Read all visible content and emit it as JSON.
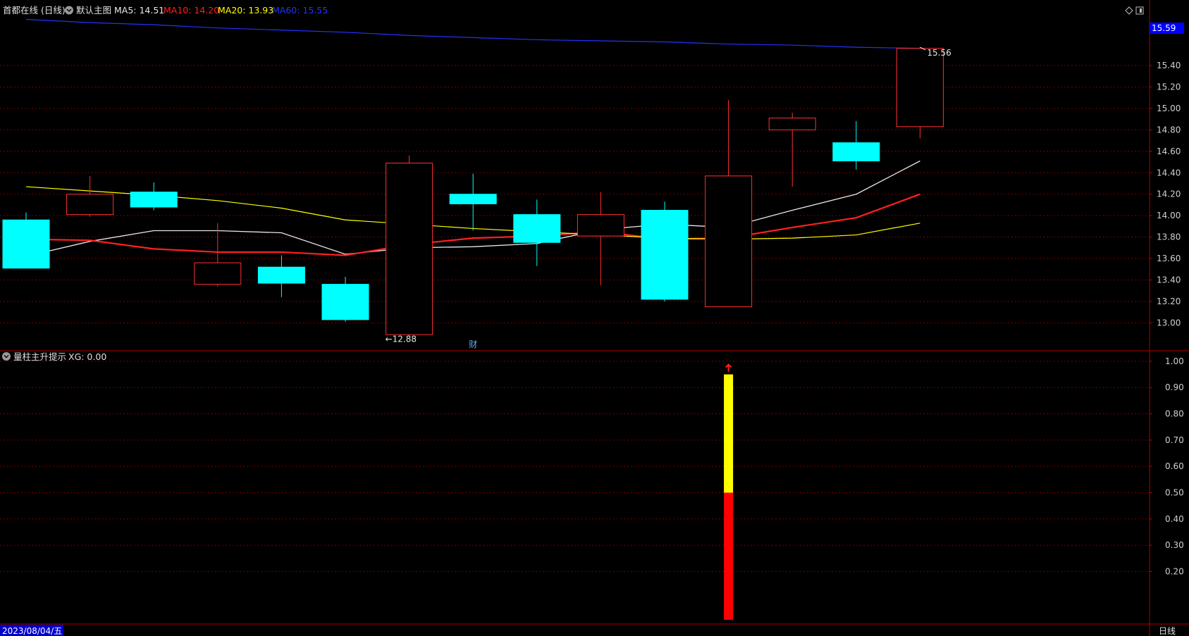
{
  "header": {
    "stock_title": "首都在线 (日线)",
    "main_chart_label": "默认主图",
    "ma_labels": [
      {
        "text": "MA5: 14.51",
        "color": "#e8e8e8"
      },
      {
        "text": "MA10: 14.20",
        "color": "#ff2020"
      },
      {
        "text": "MA20: 13.93",
        "color": "#ffff00"
      },
      {
        "text": "MA60: 15.55",
        "color": "#2233ff"
      }
    ]
  },
  "sub_header": {
    "indicator_label": "量柱主升提示",
    "xg_label": "XG: 0.00"
  },
  "footer": {
    "date_label": "2023/08/04/五",
    "period_label": "日线"
  },
  "colors": {
    "up": "#ff3030",
    "down": "#00ffff",
    "ma5": "#e8e8e8",
    "ma10": "#ff2020",
    "ma20": "#ffff00",
    "ma60": "#2233ff",
    "grid": "#7a0000",
    "axis_text": "#d0d0d0",
    "price_tag_bg": "#0000ff"
  },
  "chart_data": [
    {
      "type": "candlestick",
      "title": "首都在线 (日线)",
      "yticks": [
        "13.00",
        "13.20",
        "13.40",
        "13.60",
        "13.80",
        "14.00",
        "14.20",
        "14.40",
        "14.60",
        "14.80",
        "15.00",
        "15.20",
        "15.40"
      ],
      "ylim": [
        12.74,
        15.84
      ],
      "grid": true,
      "current_price_tag": "15.59",
      "annotations": [
        {
          "text": "←12.88",
          "at_index": 6
        },
        {
          "text": "15.56",
          "at_index": 14
        },
        {
          "text": "财",
          "at_index": 7
        }
      ],
      "candles": [
        {
          "open": 13.96,
          "close": 13.51,
          "high": 14.03,
          "low": 13.51
        },
        {
          "open": 14.01,
          "close": 14.2,
          "high": 14.37,
          "low": 13.99
        },
        {
          "open": 14.22,
          "close": 14.08,
          "high": 14.31,
          "low": 14.05
        },
        {
          "open": 13.36,
          "close": 13.56,
          "high": 13.93,
          "low": 13.34
        },
        {
          "open": 13.52,
          "close": 13.37,
          "high": 13.63,
          "low": 13.24
        },
        {
          "open": 13.36,
          "close": 13.03,
          "high": 13.43,
          "low": 13.01
        },
        {
          "open": 12.89,
          "close": 14.49,
          "high": 14.56,
          "low": 12.88
        },
        {
          "open": 14.2,
          "close": 14.11,
          "high": 14.39,
          "low": 13.86
        },
        {
          "open": 14.01,
          "close": 13.75,
          "high": 14.15,
          "low": 13.53
        },
        {
          "open": 13.81,
          "close": 14.01,
          "high": 14.22,
          "low": 13.35
        },
        {
          "open": 14.05,
          "close": 13.22,
          "high": 14.13,
          "low": 13.2
        },
        {
          "open": 13.15,
          "close": 14.37,
          "high": 15.08,
          "low": 13.15
        },
        {
          "open": 14.8,
          "close": 14.91,
          "high": 14.96,
          "low": 14.27
        },
        {
          "open": 14.68,
          "close": 14.51,
          "high": 14.88,
          "low": 14.43
        },
        {
          "open": 14.83,
          "close": 15.56,
          "high": 15.57,
          "low": 14.72
        }
      ],
      "series": [
        {
          "name": "MA5",
          "values": [
            13.62,
            13.76,
            13.86,
            13.86,
            13.84,
            13.64,
            13.7,
            13.71,
            13.74,
            13.87,
            13.92,
            13.89,
            14.05,
            14.2,
            14.51
          ]
        },
        {
          "name": "MA10",
          "values": [
            13.78,
            13.77,
            13.69,
            13.66,
            13.66,
            13.63,
            13.73,
            13.79,
            13.81,
            13.85,
            13.78,
            13.79,
            13.89,
            13.98,
            14.2
          ]
        },
        {
          "name": "MA20",
          "values": [
            14.27,
            14.23,
            14.19,
            14.14,
            14.07,
            13.96,
            13.92,
            13.88,
            13.85,
            13.82,
            13.79,
            13.78,
            13.79,
            13.82,
            13.93
          ]
        },
        {
          "name": "MA60",
          "values": [
            15.83,
            15.8,
            15.78,
            15.75,
            15.73,
            15.71,
            15.68,
            15.66,
            15.64,
            15.63,
            15.62,
            15.6,
            15.59,
            15.57,
            15.56
          ]
        }
      ]
    },
    {
      "type": "bar",
      "title": "量柱主升提示",
      "yticks": [
        "0.20",
        "0.30",
        "0.40",
        "0.50",
        "0.60",
        "0.70",
        "0.80",
        "0.90",
        "1.00"
      ],
      "ylim": [
        0.0,
        1.04
      ],
      "grid": true,
      "signal_index": 11,
      "segments": [
        {
          "from": 0.0,
          "to": 0.5,
          "color": "#ff0000"
        },
        {
          "from": 0.5,
          "to": 0.95,
          "color": "#ffff00"
        }
      ],
      "arrow_color": "#ff2020"
    }
  ]
}
